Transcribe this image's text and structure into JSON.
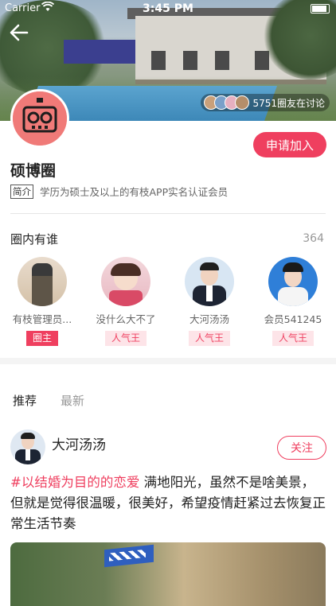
{
  "status_bar": {
    "carrier": "Carrier",
    "time": "3:45 PM"
  },
  "header": {
    "discussion_text": "5751圈友在讨论",
    "join_button": "申请加入"
  },
  "circle": {
    "name": "硕博圈",
    "intro_tag": "简介",
    "intro_text": "学历为硕士及以上的有枝APP实名认证会员"
  },
  "members_section": {
    "title": "圈内有谁",
    "count": "364",
    "members": [
      {
        "name": "有枝管理员...",
        "role": "圈主"
      },
      {
        "name": "没什么大不了",
        "role": "人气王"
      },
      {
        "name": "大河汤汤",
        "role": "人气王"
      },
      {
        "name": "会员541245",
        "role": "人气王"
      }
    ]
  },
  "tabs": [
    {
      "label": "推荐",
      "active": true
    },
    {
      "label": "最新",
      "active": false
    }
  ],
  "post": {
    "author": "大河汤汤",
    "follow_button": "关注",
    "topic": "#以结婚为目的的恋爱",
    "text": " 满地阳光，虽然不是啥美景，但就是觉得很温暖，很美好，希望疫情赶紧过去恢复正常生活节奏"
  },
  "colors": {
    "accent": "#ef3f5f",
    "accent_light": "#fde4e8"
  }
}
